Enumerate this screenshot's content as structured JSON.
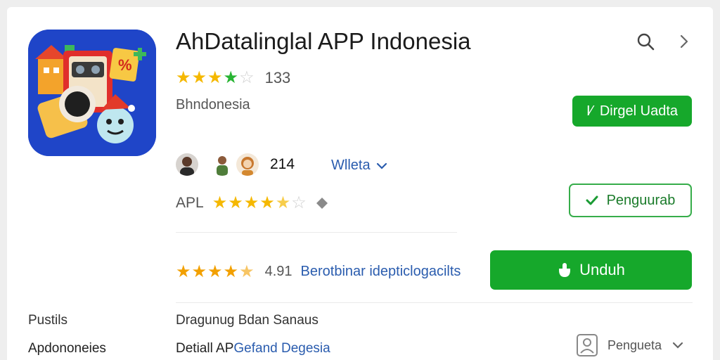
{
  "app": {
    "title": "AhDatalinglal APP Indonesia",
    "rating_count": "133",
    "developer": "Bhndonesia"
  },
  "header": {
    "search_icon": "search-icon",
    "next_icon": "chevron-right-icon"
  },
  "buttons": {
    "secondary_label": "Dirgel Uadta",
    "secondary_prefix": "I⁄",
    "outline_label": "Penguurab",
    "download_label": "Unduh"
  },
  "reviewers": {
    "count": "214",
    "dropdown_label": "Wlleta"
  },
  "apl_row": {
    "label": "APL"
  },
  "rating_row": {
    "value": "4.91",
    "description": "Berotbinar idepticlogacilts"
  },
  "bottom": {
    "left_top": "Pustils",
    "left_bottom": "Apdononeies",
    "mid_top": "Dragunug Bdan Sanaus",
    "mid_bottom_prefix": "Detiall AP",
    "mid_bottom_link": "Gefand Degesia",
    "right_label": "Pengueta"
  },
  "colors": {
    "accent_green": "#16a82b",
    "star_yellow": "#f5b800",
    "star_green": "#28b433",
    "link_blue": "#2a5cae"
  }
}
